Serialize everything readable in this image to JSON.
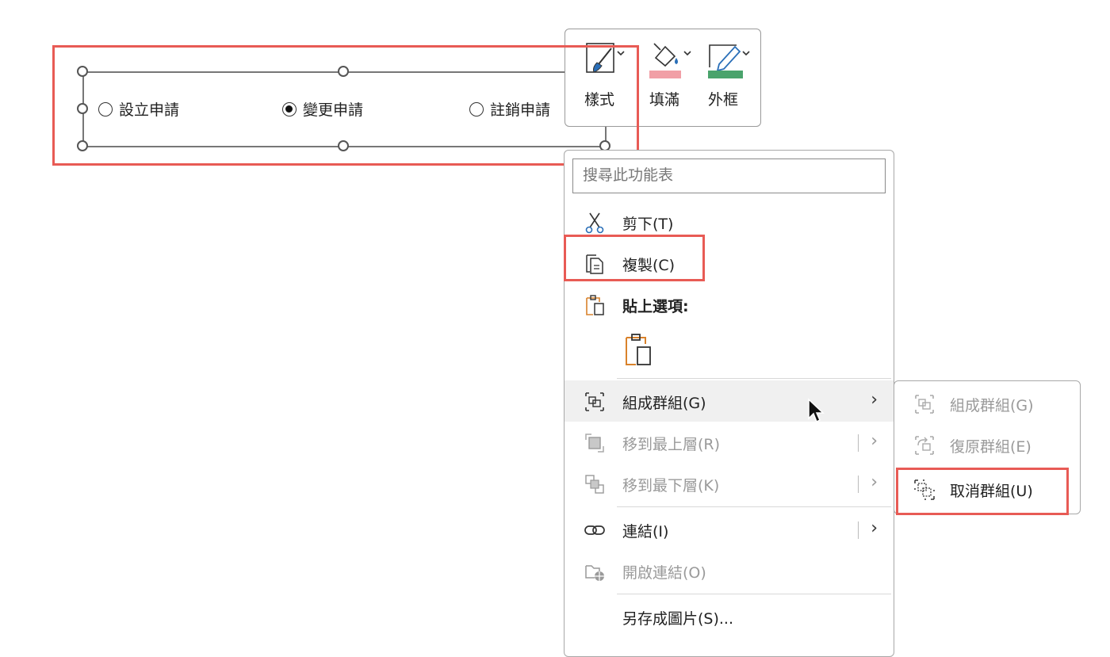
{
  "radios": [
    {
      "label": "設立申請",
      "checked": false
    },
    {
      "label": "變更申請",
      "checked": true
    },
    {
      "label": "註銷申請",
      "checked": false
    }
  ],
  "mini_toolbar": {
    "style": "樣式",
    "fill": "填滿",
    "outline": "外框"
  },
  "context_menu": {
    "search_placeholder": "搜尋此功能表",
    "cut": "剪下(T)",
    "copy": "複製(C)",
    "paste_options": "貼上選項:",
    "group": "組成群組(G)",
    "bring_front": "移到最上層(R)",
    "send_back": "移到最下層(K)",
    "link": "連結(I)",
    "open_link": "開啟連結(O)",
    "save_as_picture": "另存成圖片(S)..."
  },
  "submenu": {
    "group": "組成群組(G)",
    "regroup": "復原群組(E)",
    "ungroup": "取消群組(U)"
  },
  "colors": {
    "highlight": "#e85b55",
    "fill_swatch": "#f19fa6",
    "outline_swatch": "#4aa36c",
    "paste_icon": "#d9822b"
  }
}
